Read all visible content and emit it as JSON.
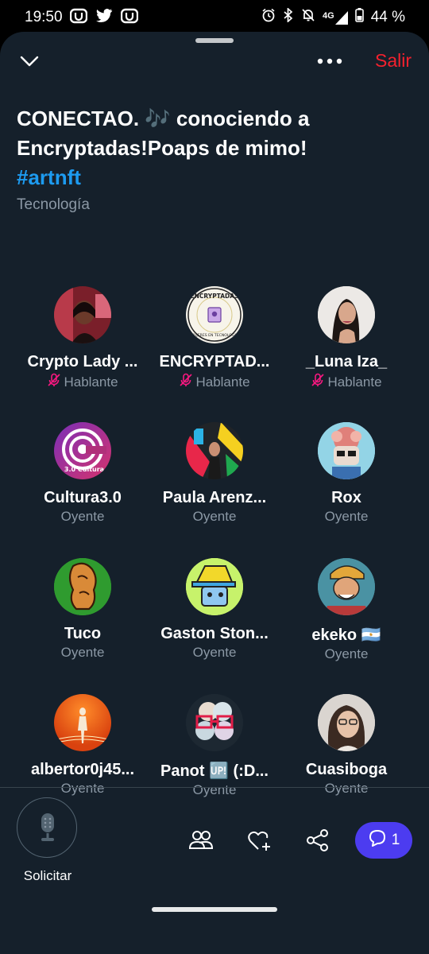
{
  "status_bar": {
    "time": "19:50",
    "network": "4G",
    "battery": "44 %"
  },
  "space": {
    "leave_label": "Salir",
    "title_main": "CONECTAO. 🎶 conociendo a Encryptadas!Poaps de mimo!",
    "title_hashtag": "#artnft",
    "category": "Tecnología"
  },
  "avatar_badges": {
    "encryptadas_top": "ENCRYPTADAS",
    "encryptadas_bottom": "MUJERES EN TECNOLOGIA",
    "cultura": "3.0 Cultura"
  },
  "participants": [
    {
      "name": "Crypto Lady ...",
      "role": "Hablante",
      "muted": true
    },
    {
      "name": "ENCRYPTAD...",
      "role": "Hablante",
      "muted": true
    },
    {
      "name": "_Luna Iza_",
      "role": "Hablante",
      "muted": true
    },
    {
      "name": "Cultura3.0",
      "role": "Oyente",
      "muted": false
    },
    {
      "name": "Paula Arenz...",
      "role": "Oyente",
      "muted": false
    },
    {
      "name": "Rox",
      "role": "Oyente",
      "muted": false
    },
    {
      "name": "Tuco",
      "role": "Oyente",
      "muted": false
    },
    {
      "name": "Gaston Ston...",
      "role": "Oyente",
      "muted": false
    },
    {
      "name": "ekeko 🇦🇷",
      "role": "Oyente",
      "muted": false
    },
    {
      "name": "albertor0j45...",
      "role": "Oyente",
      "muted": false
    },
    {
      "name": "Panot 🆙 (:D...",
      "role": "Oyente",
      "muted": false
    },
    {
      "name": "Cuasiboga",
      "role": "Oyente",
      "muted": false
    }
  ],
  "bottom_bar": {
    "request_label": "Solicitar",
    "chat_count": "1"
  },
  "colors": {
    "background": "#15202b",
    "accent_blue": "#1d9bf0",
    "leave_red": "#f4212e",
    "chat_button": "#4c3cf0",
    "muted_icon": "#f91880"
  }
}
